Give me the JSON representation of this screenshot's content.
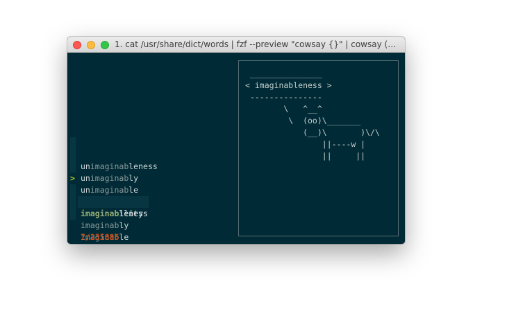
{
  "window": {
    "title": "1. cat /usr/share/dict/words | fzf --preview \"cowsay {}\" | cowsay (pe..."
  },
  "fzf": {
    "items": [
      {
        "prefix": "un",
        "match": "imaginab",
        "suffix": "leness"
      },
      {
        "prefix": "un",
        "match": "imaginab",
        "suffix": "ly"
      },
      {
        "prefix": "un",
        "match": "imaginab",
        "suffix": "le"
      },
      {
        "prefix": "",
        "match": "imaginab",
        "suffix": "leness"
      },
      {
        "prefix": "",
        "match": "imaginab",
        "suffix": "ility"
      },
      {
        "prefix": "",
        "match": "imaginab",
        "suffix": "ly"
      },
      {
        "prefix": "",
        "match": "imaginab",
        "suffix": "le"
      }
    ],
    "selected_marker": ">",
    "match_count": "7/235886",
    "prompt": ">",
    "query": "imaginab"
  },
  "preview": {
    "cowsay": " _______________\n< imaginableness >\n ---------------\n        \\   ^__^\n         \\  (oo)\\_______\n            (__)\\       )\\/\\\n                ||----w |\n                ||     ||"
  },
  "colors": {
    "terminal_bg": "#002b36",
    "highlight_bg": "#073642",
    "match_current": "#a1c92b",
    "count": "#cb4b16",
    "prompt": "#b7d333",
    "border": "#586e75"
  }
}
